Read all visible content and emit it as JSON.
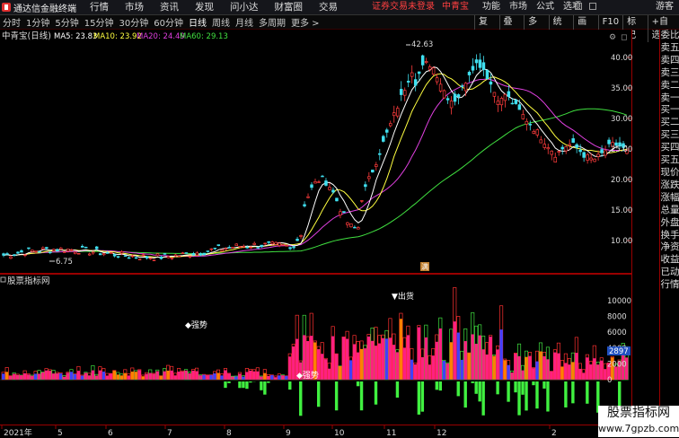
{
  "app": {
    "title": "通达信金融终端"
  },
  "menu": [
    "行情",
    "市场",
    "资讯",
    "发现",
    "问小达",
    "财富圈",
    "交易"
  ],
  "login_notice": "证券交易未登录",
  "stock_name_header": "中青宝",
  "right_tools": [
    "功能",
    "市场",
    "公式",
    "选项"
  ],
  "guest": "游客",
  "periods": [
    "分时",
    "1分钟",
    "5分钟",
    "15分钟",
    "30分钟",
    "60分钟",
    "日线",
    "周线",
    "月线",
    "多周期",
    "更多"
  ],
  "active_period": "日线",
  "panel_tools": [
    "复权",
    "叠加",
    "多股",
    "统计",
    "画线",
    "F10",
    "标记",
    "+自选"
  ],
  "main": {
    "stock_label": "中青宝(日线)",
    "ma": [
      {
        "label": "MA5: 23.83",
        "color": "#ffffff"
      },
      {
        "label": "MA10: 23.92",
        "color": "#ffff40"
      },
      {
        "label": "MA20: 24.49",
        "color": "#e040e0"
      },
      {
        "label": "MA60: 29.13",
        "color": "#40e040"
      }
    ],
    "high_label": "42.63",
    "low_label": "6.75",
    "marker": "满",
    "y_ticks": [
      "40.00",
      "35.00",
      "30.00",
      "25.00",
      "20.00",
      "15.00",
      "10.00"
    ]
  },
  "indicator": {
    "title": "股票指标网",
    "labels": [
      "强势",
      "强势",
      "出货"
    ],
    "y_ticks": [
      "10000",
      "8000",
      "6000",
      "4000",
      "2000",
      "0"
    ],
    "current_value": "2897"
  },
  "x_axis": [
    "2021年",
    "5",
    "6",
    "7",
    "8",
    "9",
    "10",
    "11",
    "12",
    "2"
  ],
  "side_panel": [
    "委比",
    "卖五",
    "卖四",
    "卖三",
    "卖二",
    "卖一",
    "买一",
    "买二",
    "买三",
    "买四",
    "买五",
    "现价",
    "涨跌",
    "涨幅",
    "总量",
    "外盘",
    "换手",
    "净资",
    "收益",
    "已动",
    "行情"
  ],
  "watermark": {
    "title": "股票指标网",
    "url": "www.7gpzb.com"
  },
  "colors": {
    "up": "#ff3c3c",
    "down": "#40e0f0",
    "ma5": "#ffffff",
    "ma10": "#ffff40",
    "ma20": "#e040e0",
    "ma60": "#40e040",
    "green_bar": "#40f040",
    "blue_bar": "#4040ff",
    "orange": "#ff8000"
  }
}
